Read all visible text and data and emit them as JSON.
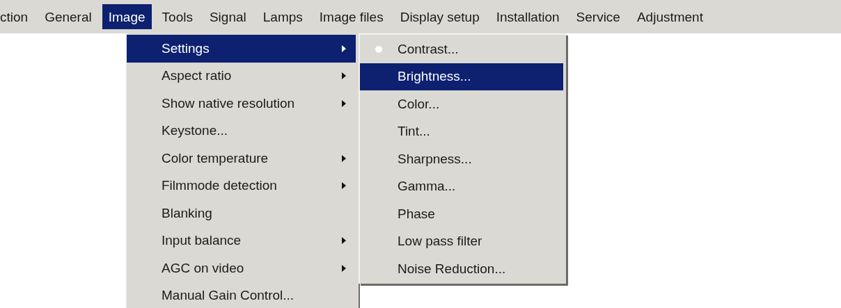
{
  "menu_bar": [
    {
      "label": "ction",
      "selected": false
    },
    {
      "label": "General",
      "selected": false
    },
    {
      "label": "Image",
      "selected": true
    },
    {
      "label": "Tools",
      "selected": false
    },
    {
      "label": "Signal",
      "selected": false
    },
    {
      "label": "Lamps",
      "selected": false
    },
    {
      "label": "Image files",
      "selected": false
    },
    {
      "label": "Display setup",
      "selected": false
    },
    {
      "label": "Installation",
      "selected": false
    },
    {
      "label": "Service",
      "selected": false
    },
    {
      "label": "Adjustment",
      "selected": false
    }
  ],
  "image_menu": [
    {
      "label": "Settings",
      "selected": true,
      "has_submenu": true
    },
    {
      "label": "Aspect ratio",
      "selected": false,
      "has_submenu": true
    },
    {
      "label": "Show native resolution",
      "selected": false,
      "has_submenu": true
    },
    {
      "label": "Keystone...",
      "selected": false,
      "has_submenu": false
    },
    {
      "label": "Color temperature",
      "selected": false,
      "has_submenu": true
    },
    {
      "label": "Filmmode detection",
      "selected": false,
      "has_submenu": true
    },
    {
      "label": "Blanking",
      "selected": false,
      "has_submenu": false
    },
    {
      "label": "Input balance",
      "selected": false,
      "has_submenu": true
    },
    {
      "label": "AGC on video",
      "selected": false,
      "has_submenu": true
    },
    {
      "label": "Manual Gain Control...",
      "selected": false,
      "has_submenu": false
    }
  ],
  "settings_menu": [
    {
      "label": "Contrast...",
      "selected": false,
      "current": true
    },
    {
      "label": "Brightness...",
      "selected": true,
      "current": false
    },
    {
      "label": "Color...",
      "selected": false,
      "current": false
    },
    {
      "label": "Tint...",
      "selected": false,
      "current": false
    },
    {
      "label": "Sharpness...",
      "selected": false,
      "current": false
    },
    {
      "label": "Gamma...",
      "selected": false,
      "current": false
    },
    {
      "label": "Phase",
      "selected": false,
      "current": false
    },
    {
      "label": "Low pass filter",
      "selected": false,
      "current": false
    },
    {
      "label": "Noise Reduction...",
      "selected": false,
      "current": false
    }
  ]
}
